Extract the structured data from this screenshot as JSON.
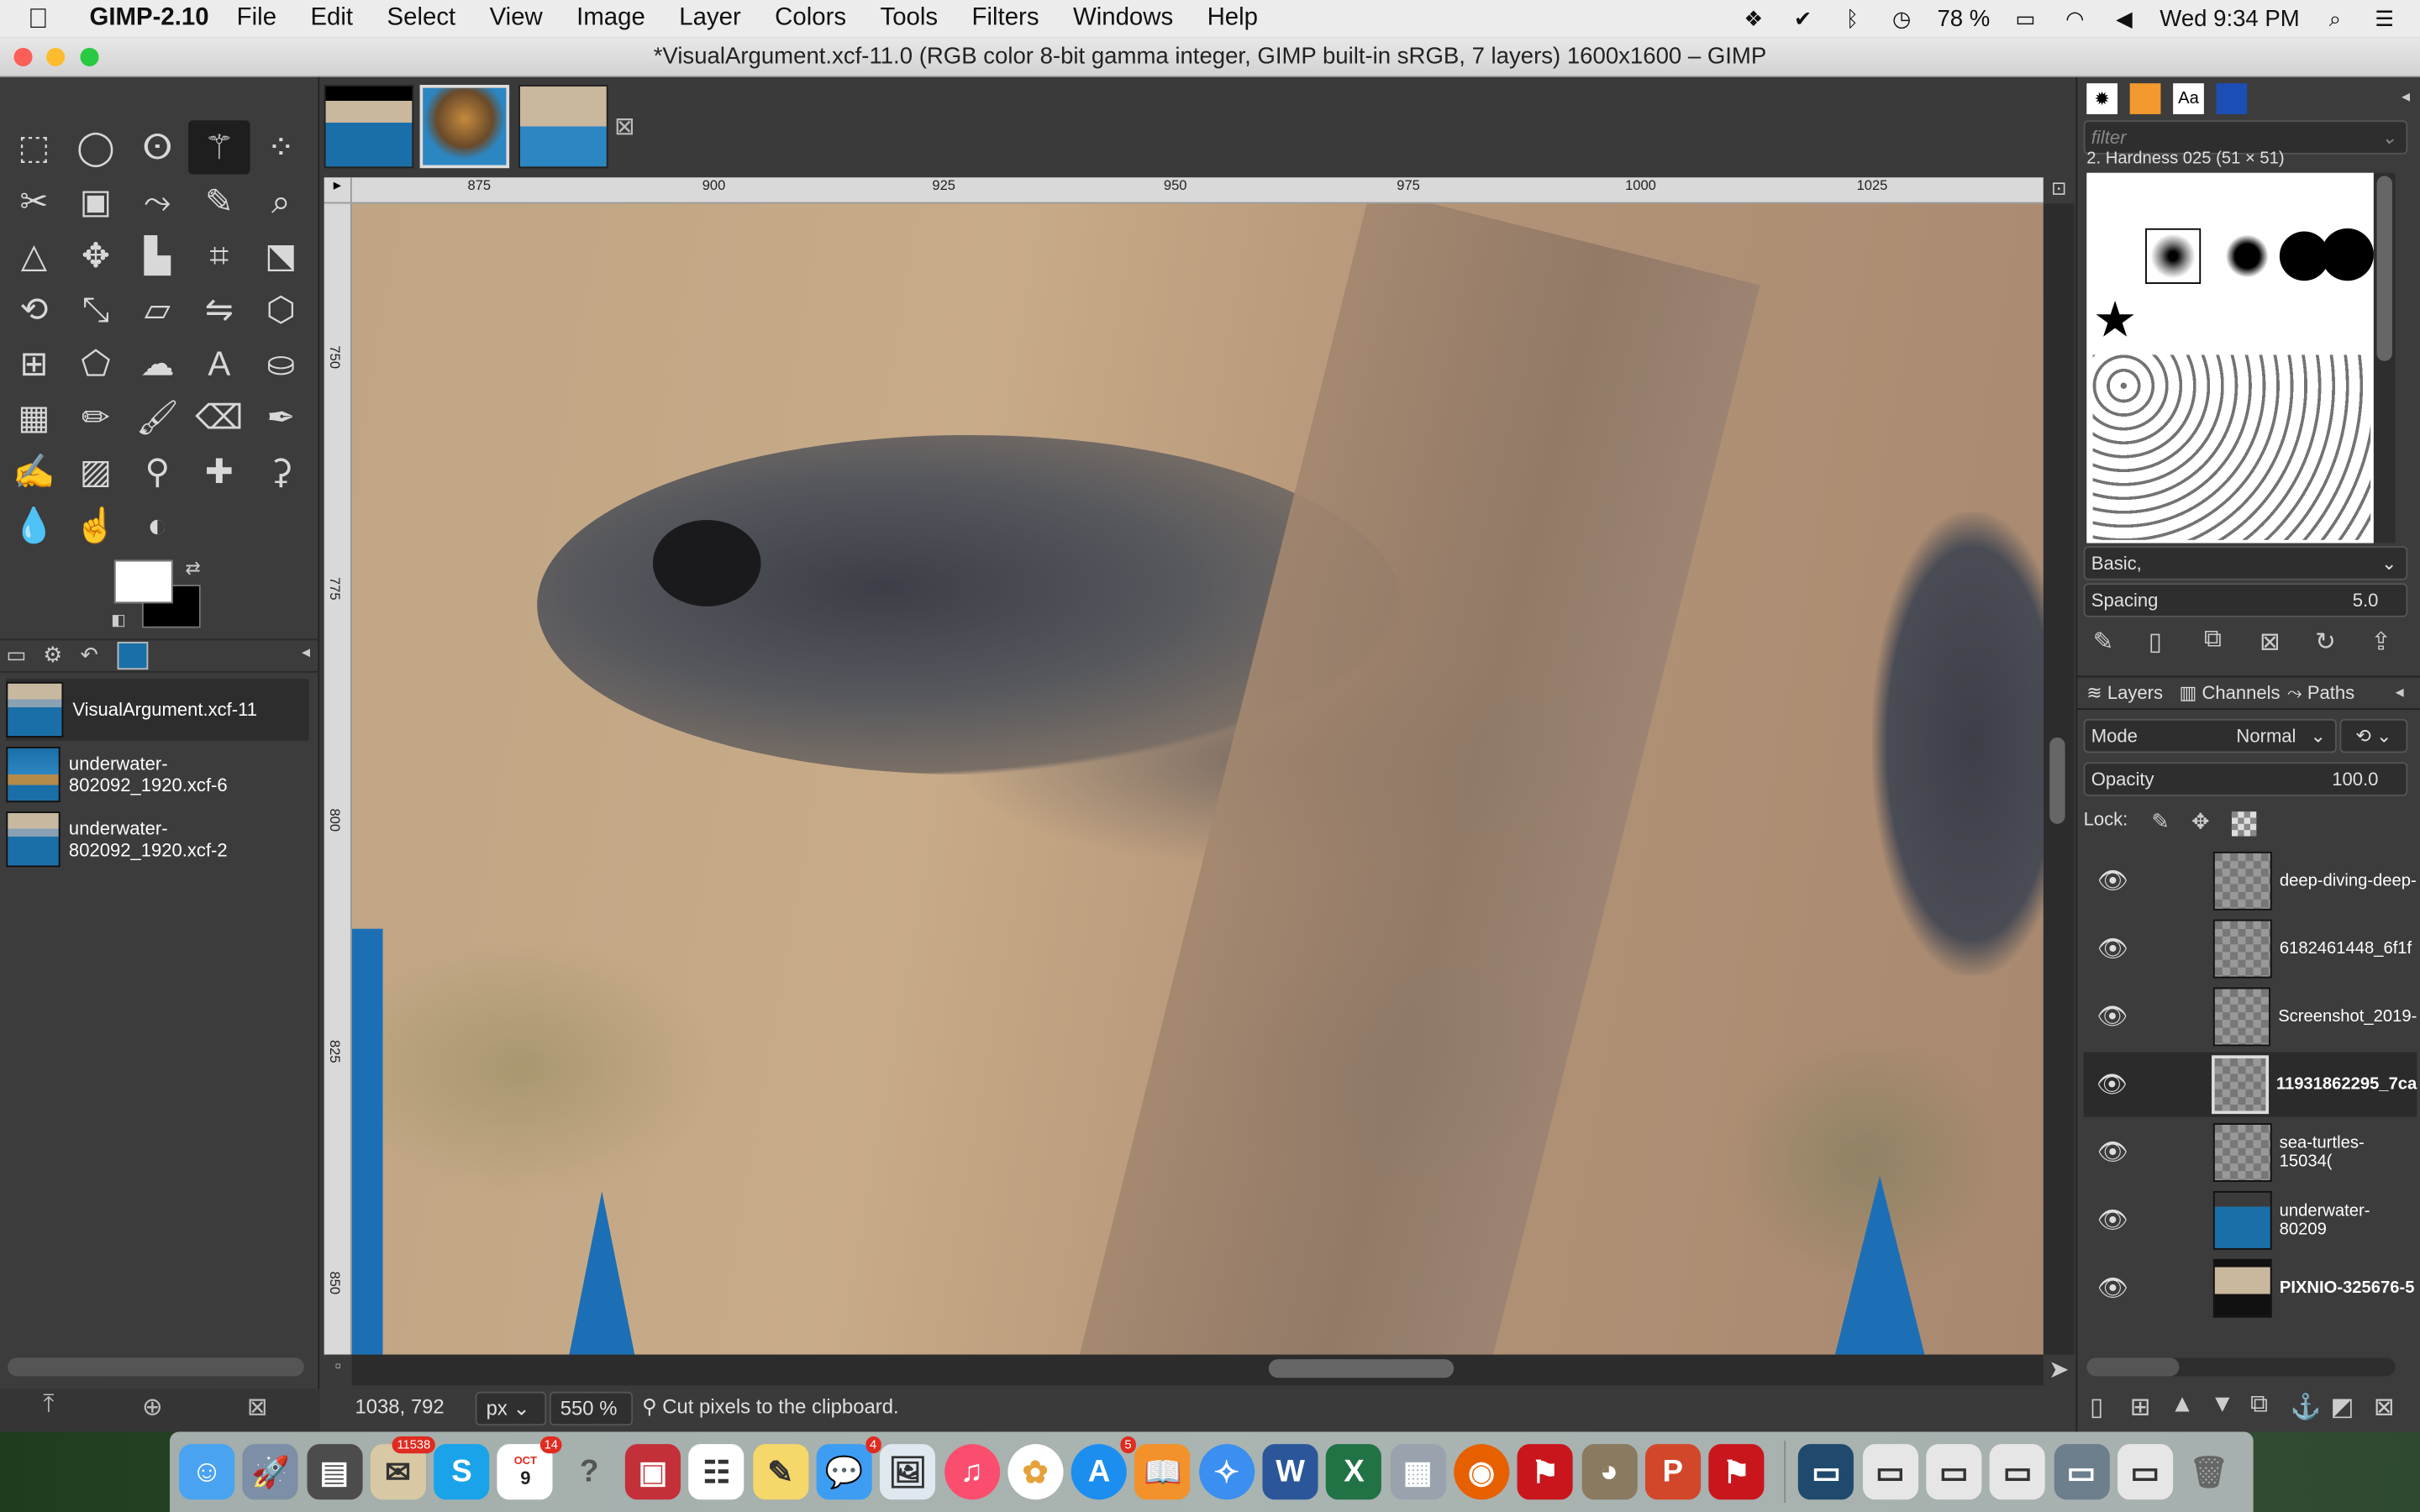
{
  "menubar": {
    "app_name": "GIMP-2.10",
    "menus": [
      "File",
      "Edit",
      "Select",
      "View",
      "Image",
      "Layer",
      "Colors",
      "Tools",
      "Filters",
      "Windows",
      "Help"
    ],
    "battery": "78 %",
    "clock": "Wed 9:34 PM"
  },
  "window": {
    "title": "*VisualArgument.xcf-11.0 (RGB color 8-bit gamma integer, GIMP built-in sRGB, 7 layers) 1600x1600 – GIMP"
  },
  "images": [
    {
      "label": "VisualArgument.xcf-11",
      "selected": true
    },
    {
      "label": "underwater-802092_1920.xcf-6",
      "selected": false
    },
    {
      "label": "underwater-802092_1920.xcf-2",
      "selected": false
    }
  ],
  "ruler": {
    "top_labels": [
      "875",
      "900",
      "925",
      "950",
      "975",
      "1000",
      "1025"
    ],
    "left_labels": [
      "750",
      "775",
      "800",
      "825",
      "850"
    ]
  },
  "status": {
    "coords": "1038, 792",
    "unit": "px",
    "zoom": "550 %",
    "message": "Cut pixels to the clipboard."
  },
  "brushes": {
    "filter_placeholder": "filter",
    "selected_brush": "2. Hardness 025 (51 × 51)",
    "preset": "Basic,",
    "spacing_label": "Spacing",
    "spacing_value": "5.0"
  },
  "layers_panel": {
    "tabs": [
      "Layers",
      "Channels",
      "Paths"
    ],
    "mode_label": "Mode",
    "mode_value": "Normal",
    "opacity_label": "Opacity",
    "opacity_value": "100.0",
    "lock_label": "Lock:",
    "layers": [
      {
        "name": "deep-diving-deep-",
        "selected": false
      },
      {
        "name": "6182461448_6f1f",
        "selected": false
      },
      {
        "name": "Screenshot_2019-",
        "selected": false
      },
      {
        "name": "11931862295_7ca",
        "selected": true
      },
      {
        "name": "sea-turtles-15034(",
        "selected": false
      },
      {
        "name": "underwater-80209",
        "selected": false
      },
      {
        "name": "PIXNIO-325676-5",
        "selected": false
      }
    ]
  },
  "dock": {
    "badges": {
      "mail": "11538",
      "calendar_month": "OCT",
      "calendar_day": "9",
      "calendar_badge": "14",
      "messages": "4",
      "appstore": "5"
    },
    "word": "W",
    "excel": "X"
  },
  "colors": {
    "accent_selected": "#2b2b2b",
    "canvas_blue": "#1d6fb5"
  }
}
